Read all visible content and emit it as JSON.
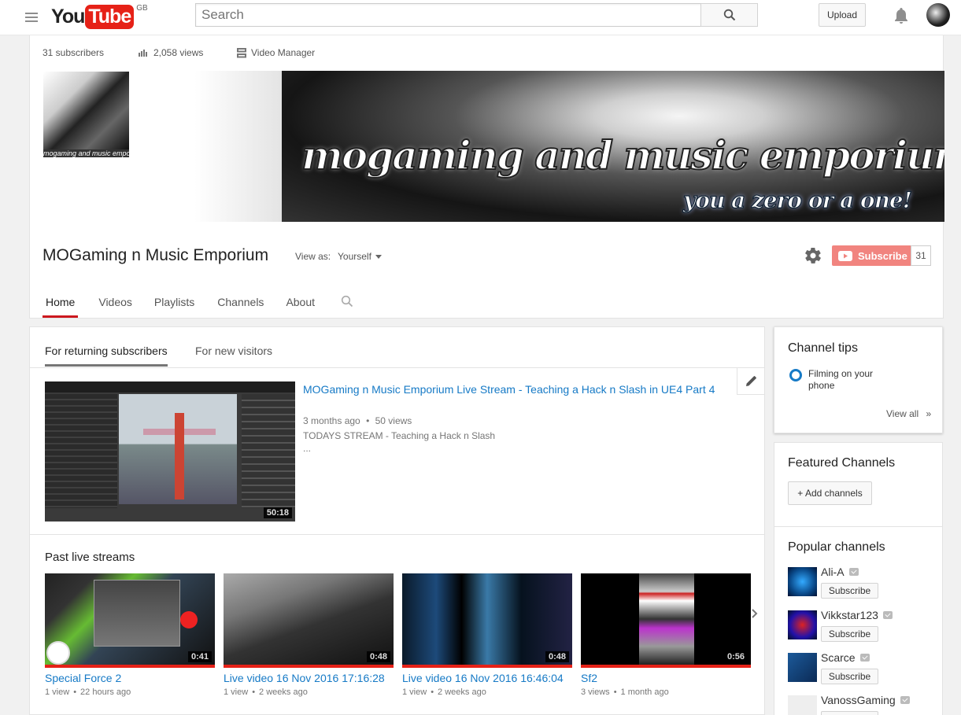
{
  "masthead": {
    "logo_you": "You",
    "logo_tube": "Tube",
    "region": "GB",
    "search_placeholder": "Search",
    "upload_label": "Upload"
  },
  "channel": {
    "subscribers": "31 subscribers",
    "views": "2,058 views",
    "video_manager": "Video Manager",
    "name": "MOGaming n Music Emporium",
    "view_as_label": "View as:",
    "view_as_value": "Yourself",
    "subscribe_label": "Subscribe",
    "subscribe_count": "31",
    "avatar_caption": "mogaming and music emporium",
    "banner_title": "mogaming and music emporium",
    "banner_tagline": "you a zero or a one!",
    "tabs": [
      {
        "label": "Home"
      },
      {
        "label": "Videos"
      },
      {
        "label": "Playlists"
      },
      {
        "label": "Channels"
      },
      {
        "label": "About"
      }
    ]
  },
  "main": {
    "subtabs": [
      {
        "label": "For returning subscribers"
      },
      {
        "label": "For new visitors"
      }
    ],
    "featured": {
      "title": "MOGaming n Music Emporium Live Stream - Teaching a Hack n Slash in UE4 Part 4",
      "age": "3 months ago",
      "views": "50 views",
      "separator": "•",
      "description": "TODAYS STREAM - Teaching a Hack n Slash",
      "more": "...",
      "duration": "50:18"
    },
    "shelf": {
      "title": "Past live streams",
      "videos": [
        {
          "title": "Special Force 2",
          "views": "1 view",
          "age": "22 hours ago",
          "duration": "0:41"
        },
        {
          "title": "Live video 16 Nov 2016 17:16:28",
          "views": "1 view",
          "age": "2 weeks ago",
          "duration": "0:48"
        },
        {
          "title": "Live video 16 Nov 2016 16:46:04",
          "views": "1 view",
          "age": "2 weeks ago",
          "duration": "0:48"
        },
        {
          "title": "Sf2",
          "views": "3 views",
          "age": "1 month ago",
          "duration": "0:56"
        }
      ]
    }
  },
  "sidebar": {
    "tips": {
      "title": "Channel tips",
      "item": "Filming on your phone",
      "view_all": "View all"
    },
    "featured": {
      "title": "Featured Channels",
      "add_label": "+ Add channels"
    },
    "popular": {
      "title": "Popular channels",
      "subscribe_label": "Subscribe",
      "channels": [
        {
          "name": "Ali-A"
        },
        {
          "name": "Vikkstar123"
        },
        {
          "name": "Scarce"
        },
        {
          "name": "VanossGaming"
        }
      ]
    }
  },
  "colors": {
    "brand_red": "#e62117",
    "link_blue": "#167ac6"
  }
}
